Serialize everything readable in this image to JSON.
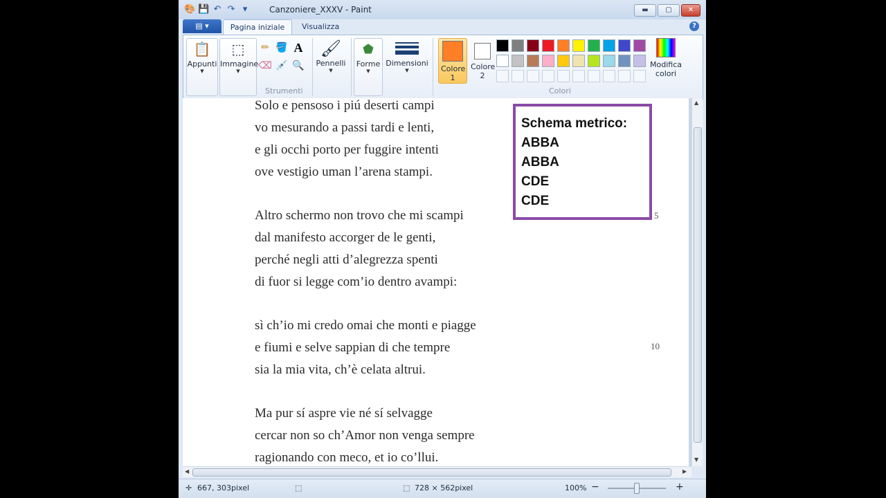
{
  "window": {
    "title": "Canzoniere_XXXV - Paint",
    "controls": {
      "minimize": "▬",
      "maximize": "▢",
      "close": "✕"
    }
  },
  "quick_access": {
    "app": "🎨",
    "save": "💾",
    "undo": "↶",
    "redo": "↷",
    "more": "▾"
  },
  "ribbon": {
    "file_menu": "▤ ▾",
    "tabs": [
      "Pagina iniziale",
      "Visualizza"
    ],
    "help": "?",
    "appunti_label": "Appunti",
    "immagine_label": "Immagine",
    "strumenti_label": "Strumenti",
    "pennelli_label": "Pennelli",
    "forme_label": "Forme",
    "dimensioni_label": "Dimensioni",
    "colore1_label": "Colore 1",
    "colore2_label": "Colore 2",
    "colori_label": "Colori",
    "modifica_colori_label": "Modifica colori",
    "tool_glyphs": {
      "pencil": "✏",
      "fill": "🪣",
      "text": "A",
      "eraser": "⌫",
      "picker": "💉",
      "magnifier": "🔍"
    },
    "colors": {
      "primary": "#ff7f27",
      "secondary": "#ffffff",
      "palette_row1": [
        "#000000",
        "#7f7f7f",
        "#880015",
        "#ed1c24",
        "#ff7f27",
        "#fff200",
        "#22b14c",
        "#00a2e8",
        "#3f48cc",
        "#a349a4"
      ],
      "palette_row2": [
        "#ffffff",
        "#c3c3c3",
        "#b97a57",
        "#ffaec9",
        "#ffc90e",
        "#efe4b0",
        "#b5e61d",
        "#99d9ea",
        "#7092be",
        "#c8bfe7"
      ]
    }
  },
  "canvas": {
    "poem_lines": [
      "Solo e  pensoso i piú deserti campi",
      "vo mesurando a passi tardi e  lenti,",
      "e  gli occhi porto per fuggire intenti",
      "ove vestigio   uman l’arena stampi.",
      "Altro schermo non trovo che mi scampi",
      "dal manifesto accorger de le genti,",
      "perché negli atti d’alegrezza spenti",
      "di fuor si legge com’io dentro avampi:",
      "sì ch’io mi credo omai che monti e  piagge",
      "e  fiumi e  selve sappian di che tempre",
      "sia la mia vita, ch’è celata altrui.",
      "Ma pur sí aspre vie né sí selvagge",
      "cercar non so ch’Amor non venga sempre",
      "ragionando con meco, et io co’llui."
    ],
    "line_numbers": [
      "5",
      "10"
    ],
    "schema_box": {
      "title": "Schema metrico:",
      "lines": [
        "ABBA",
        "ABBA",
        "CDE",
        "CDE"
      ]
    }
  },
  "statusbar": {
    "cursor_pos": "667, 303pixel",
    "canvas_size": "728 × 562pixel",
    "zoom": "100%",
    "zoom_out": "−",
    "zoom_in": "+"
  }
}
